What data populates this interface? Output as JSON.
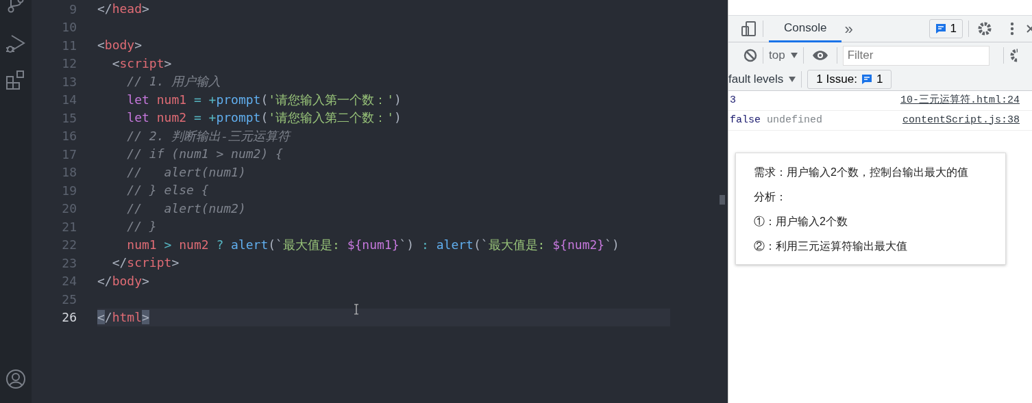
{
  "editor": {
    "lines": [
      {
        "number": "9",
        "current": false,
        "tokens": [
          {
            "kind": "punct",
            "text": "</"
          },
          {
            "kind": "tag",
            "text": "head"
          },
          {
            "kind": "punct",
            "text": ">"
          }
        ]
      },
      {
        "number": "10",
        "current": false
      },
      {
        "number": "11",
        "current": false,
        "tokens": [
          {
            "kind": "punct",
            "text": "<"
          },
          {
            "kind": "tag",
            "text": "body"
          },
          {
            "kind": "punct",
            "text": ">"
          }
        ]
      },
      {
        "number": "12",
        "current": false,
        "tokens": [
          {
            "kind": "punct",
            "text": "  <"
          },
          {
            "kind": "tag",
            "text": "script"
          },
          {
            "kind": "punct",
            "text": ">"
          }
        ]
      },
      {
        "number": "13",
        "current": false,
        "tokens": [
          {
            "kind": "comment",
            "text": "    // 1. 用户输入"
          }
        ]
      },
      {
        "number": "14",
        "current": false,
        "tokens": [
          {
            "kind": "keyword",
            "text": "    let "
          },
          {
            "kind": "var",
            "text": "num1"
          },
          {
            "kind": "op",
            "text": " = +"
          },
          {
            "kind": "func",
            "text": "prompt"
          },
          {
            "kind": "punct",
            "text": "("
          },
          {
            "kind": "string",
            "text": "'请您输入第一个数：'"
          },
          {
            "kind": "punct",
            "text": ")"
          }
        ]
      },
      {
        "number": "15",
        "current": false,
        "tokens": [
          {
            "kind": "keyword",
            "text": "    let "
          },
          {
            "kind": "var",
            "text": "num2"
          },
          {
            "kind": "op",
            "text": " = +"
          },
          {
            "kind": "func",
            "text": "prompt"
          },
          {
            "kind": "punct",
            "text": "("
          },
          {
            "kind": "string",
            "text": "'请您输入第二个数：'"
          },
          {
            "kind": "punct",
            "text": ")"
          }
        ]
      },
      {
        "number": "16",
        "current": false,
        "tokens": [
          {
            "kind": "comment",
            "text": "    // 2. 判断输出-三元运算符"
          }
        ]
      },
      {
        "number": "17",
        "current": false,
        "tokens": [
          {
            "kind": "comment",
            "text": "    // if (num1 > num2) {"
          }
        ]
      },
      {
        "number": "18",
        "current": false,
        "tokens": [
          {
            "kind": "comment",
            "text": "    //   alert(num1)"
          }
        ]
      },
      {
        "number": "19",
        "current": false,
        "tokens": [
          {
            "kind": "comment",
            "text": "    // } else {"
          }
        ]
      },
      {
        "number": "20",
        "current": false,
        "tokens": [
          {
            "kind": "comment",
            "text": "    //   alert(num2)"
          }
        ]
      },
      {
        "number": "21",
        "current": false,
        "tokens": [
          {
            "kind": "comment",
            "text": "    // }"
          }
        ]
      },
      {
        "number": "22",
        "current": false,
        "tokens": [
          {
            "kind": "var",
            "text": "    num1"
          },
          {
            "kind": "op",
            "text": " > "
          },
          {
            "kind": "var",
            "text": "num2"
          },
          {
            "kind": "op",
            "text": " ? "
          },
          {
            "kind": "func",
            "text": "alert"
          },
          {
            "kind": "punct",
            "text": "(`"
          },
          {
            "kind": "string",
            "text": "最大值是: "
          },
          {
            "kind": "keyword",
            "text": "${num1}"
          },
          {
            "kind": "punct",
            "text": "`) "
          },
          {
            "kind": "op",
            "text": ": "
          },
          {
            "kind": "func",
            "text": "alert"
          },
          {
            "kind": "punct",
            "text": "(`"
          },
          {
            "kind": "string",
            "text": "最大值是: "
          },
          {
            "kind": "keyword",
            "text": "${num2}"
          },
          {
            "kind": "punct",
            "text": "`)"
          }
        ]
      },
      {
        "number": "23",
        "current": false,
        "tokens": [
          {
            "kind": "punct",
            "text": "  </"
          },
          {
            "kind": "tag",
            "text": "script"
          },
          {
            "kind": "punct",
            "text": ">"
          }
        ]
      },
      {
        "number": "24",
        "current": false,
        "tokens": [
          {
            "kind": "punct",
            "text": "</"
          },
          {
            "kind": "tag",
            "text": "body"
          },
          {
            "kind": "punct",
            "text": ">"
          }
        ]
      },
      {
        "number": "25",
        "current": false
      },
      {
        "number": "26",
        "current": true,
        "tokens": [
          {
            "kind": "bracket-match",
            "text": "<"
          },
          {
            "kind": "punct",
            "text": "/"
          },
          {
            "kind": "tag",
            "text": "html"
          },
          {
            "kind": "bracket-match",
            "text": ">"
          }
        ]
      }
    ]
  },
  "devtools": {
    "tabs": [
      {
        "label": "Console",
        "selected": true
      }
    ],
    "more_tabs": "»",
    "issues_count": "1",
    "context": "top",
    "filter": {
      "placeholder": "Filter"
    },
    "levels": "fault levels",
    "issues_button": {
      "label": "1 Issue:",
      "count": "1"
    },
    "messages": [
      {
        "tokens": [
          {
            "kind": "value",
            "text": "3"
          }
        ],
        "source": "10-三元运算符.html:24"
      },
      {
        "tokens": [
          {
            "kind": "value",
            "text": "false"
          },
          {
            "kind": "muted",
            "text": "undefined"
          }
        ],
        "source": "contentScript.js:38"
      }
    ]
  },
  "slide": {
    "lines": [
      "需求：用户输入2个数，控制台输出最大的值",
      "分析：",
      "①：用户输入2个数",
      "②：利用三元运算符输出最大值"
    ]
  }
}
